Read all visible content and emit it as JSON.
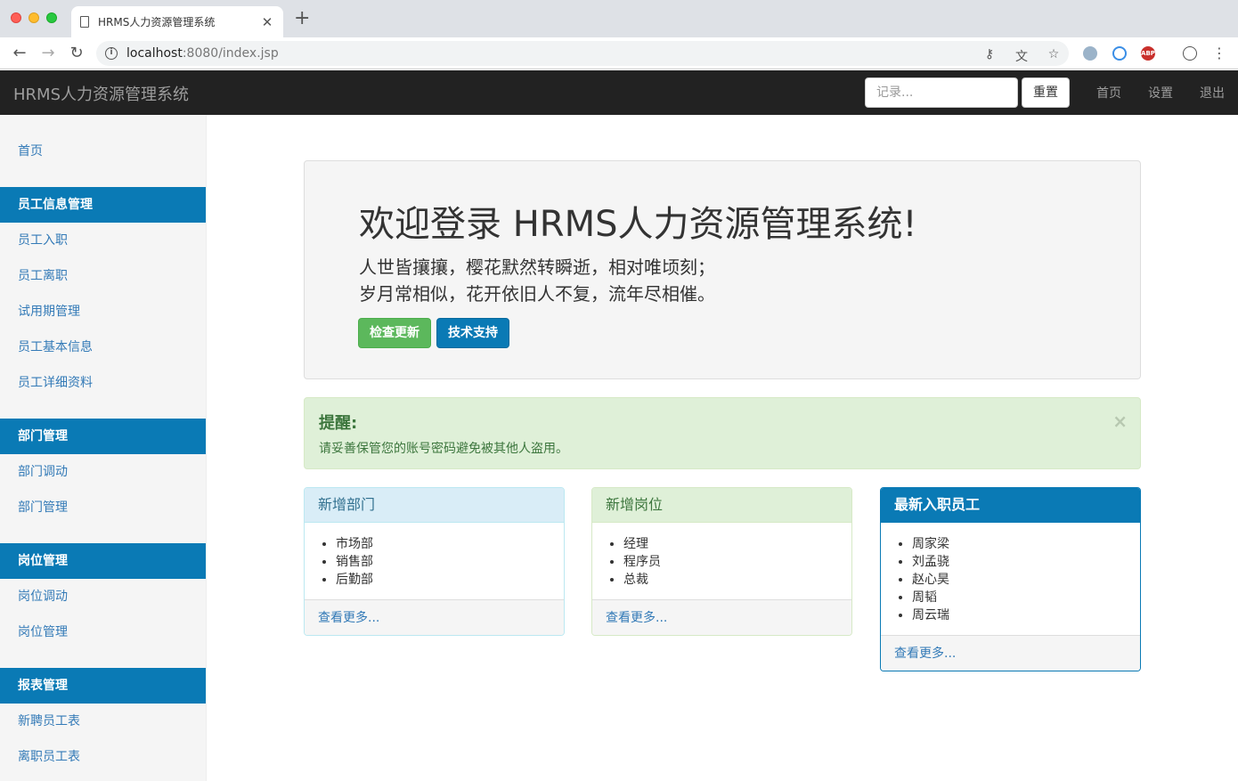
{
  "browser": {
    "tab_title": "HRMS人力资源管理系统",
    "url_host": "localhost",
    "url_rest": ":8080/index.jsp"
  },
  "navbar": {
    "brand": "HRMS人力资源管理系统",
    "search_placeholder": "记录...",
    "reset_label": "重置",
    "links": [
      "首页",
      "设置",
      "退出"
    ]
  },
  "sidebar": {
    "home": "首页",
    "sections": [
      {
        "title": "员工信息管理",
        "items": [
          "员工入职",
          "员工离职",
          "试用期管理",
          "员工基本信息",
          "员工详细资料"
        ]
      },
      {
        "title": "部门管理",
        "items": [
          "部门调动",
          "部门管理"
        ]
      },
      {
        "title": "岗位管理",
        "items": [
          "岗位调动",
          "岗位管理"
        ]
      },
      {
        "title": "报表管理",
        "items": [
          "新聘员工表",
          "离职员工表"
        ]
      }
    ]
  },
  "jumbotron": {
    "title": "欢迎登录 HRMS人力资源管理系统!",
    "line1": "人世皆攘攘，樱花默然转瞬逝，相对唯顷刻；",
    "line2": "岁月常相似，花开依旧人不复，流年尽相催。",
    "btn_update": "检查更新",
    "btn_support": "技术支持"
  },
  "alert": {
    "title": "提醒:",
    "text": "请妥善保管您的账号密码避免被其他人盗用。",
    "close": "×"
  },
  "panels": {
    "departments": {
      "title": "新增部门",
      "items": [
        "市场部",
        "销售部",
        "后勤部"
      ],
      "more": "查看更多..."
    },
    "positions": {
      "title": "新增岗位",
      "items": [
        "经理",
        "程序员",
        "总裁"
      ],
      "more": "查看更多..."
    },
    "employees": {
      "title": "最新入职员工",
      "items": [
        "周家梁",
        "刘孟骁",
        "赵心昊",
        "周韬",
        "周云瑞"
      ],
      "more": "查看更多..."
    }
  }
}
